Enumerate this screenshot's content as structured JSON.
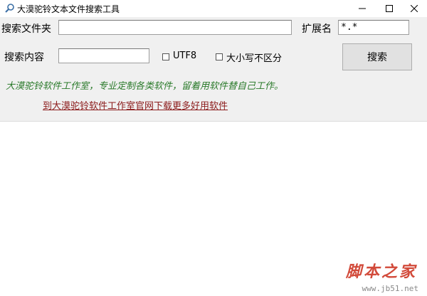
{
  "window": {
    "title": "大漠驼铃文本文件搜索工具",
    "icons": [
      "magnifier-icon",
      "minimize-icon",
      "maximize-icon",
      "close-icon"
    ]
  },
  "form": {
    "folder_label": "搜索文件夹",
    "folder_value": "",
    "ext_label": "扩展名",
    "ext_value": "*.*",
    "content_label": "搜索内容",
    "content_value": "",
    "utf8_label": "UTF8",
    "utf8_checked": false,
    "case_label": "大小写不区分",
    "case_checked": false,
    "search_button": "搜索"
  },
  "info": {
    "slogan": "大漠驼铃软件工作室，专业定制各类软件，留着用软件替自己工作。",
    "link_text": "到大漠驼铃软件工作室官网下载更多好用软件",
    "link_color": "#8b1a1a",
    "slogan_color": "#2a7a2a"
  },
  "watermark": {
    "text": "脚本之家",
    "url": "www.jb51.net"
  }
}
